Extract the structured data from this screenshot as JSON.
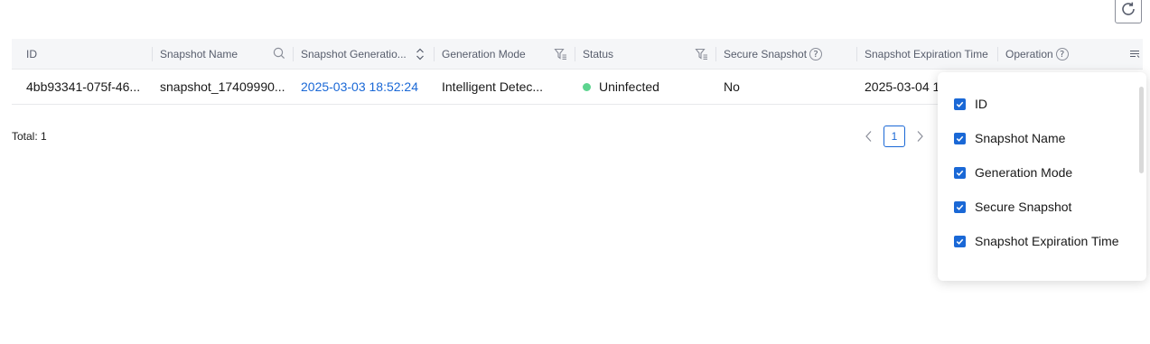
{
  "toolbar": {
    "refresh_icon": "refresh-icon"
  },
  "table": {
    "columns": [
      {
        "label": "ID"
      },
      {
        "label": "Snapshot Name"
      },
      {
        "label": "Snapshot Generatio..."
      },
      {
        "label": "Generation Mode"
      },
      {
        "label": "Status"
      },
      {
        "label": "Secure Snapshot"
      },
      {
        "label": "Snapshot Expiration Time"
      },
      {
        "label": "Operation"
      }
    ],
    "rows": [
      {
        "id": "4bb93341-075f-46...",
        "name": "snapshot_17409990...",
        "generation_time": "2025-03-03 18:52:24",
        "mode": "Intelligent Detec...",
        "status": "Uninfected",
        "secure": "No",
        "expiration": "2025-03-04 1"
      }
    ]
  },
  "footer": {
    "total": "Total: 1",
    "current_page": "1"
  },
  "column_settings": {
    "options": [
      {
        "label": "ID",
        "checked": true
      },
      {
        "label": "Snapshot Name",
        "checked": true
      },
      {
        "label": "Generation Mode",
        "checked": true
      },
      {
        "label": "Secure Snapshot",
        "checked": true
      },
      {
        "label": "Snapshot Expiration Time",
        "checked": true
      }
    ]
  },
  "colors": {
    "accent": "#1a68d6",
    "status_ok": "#5dd48f"
  }
}
